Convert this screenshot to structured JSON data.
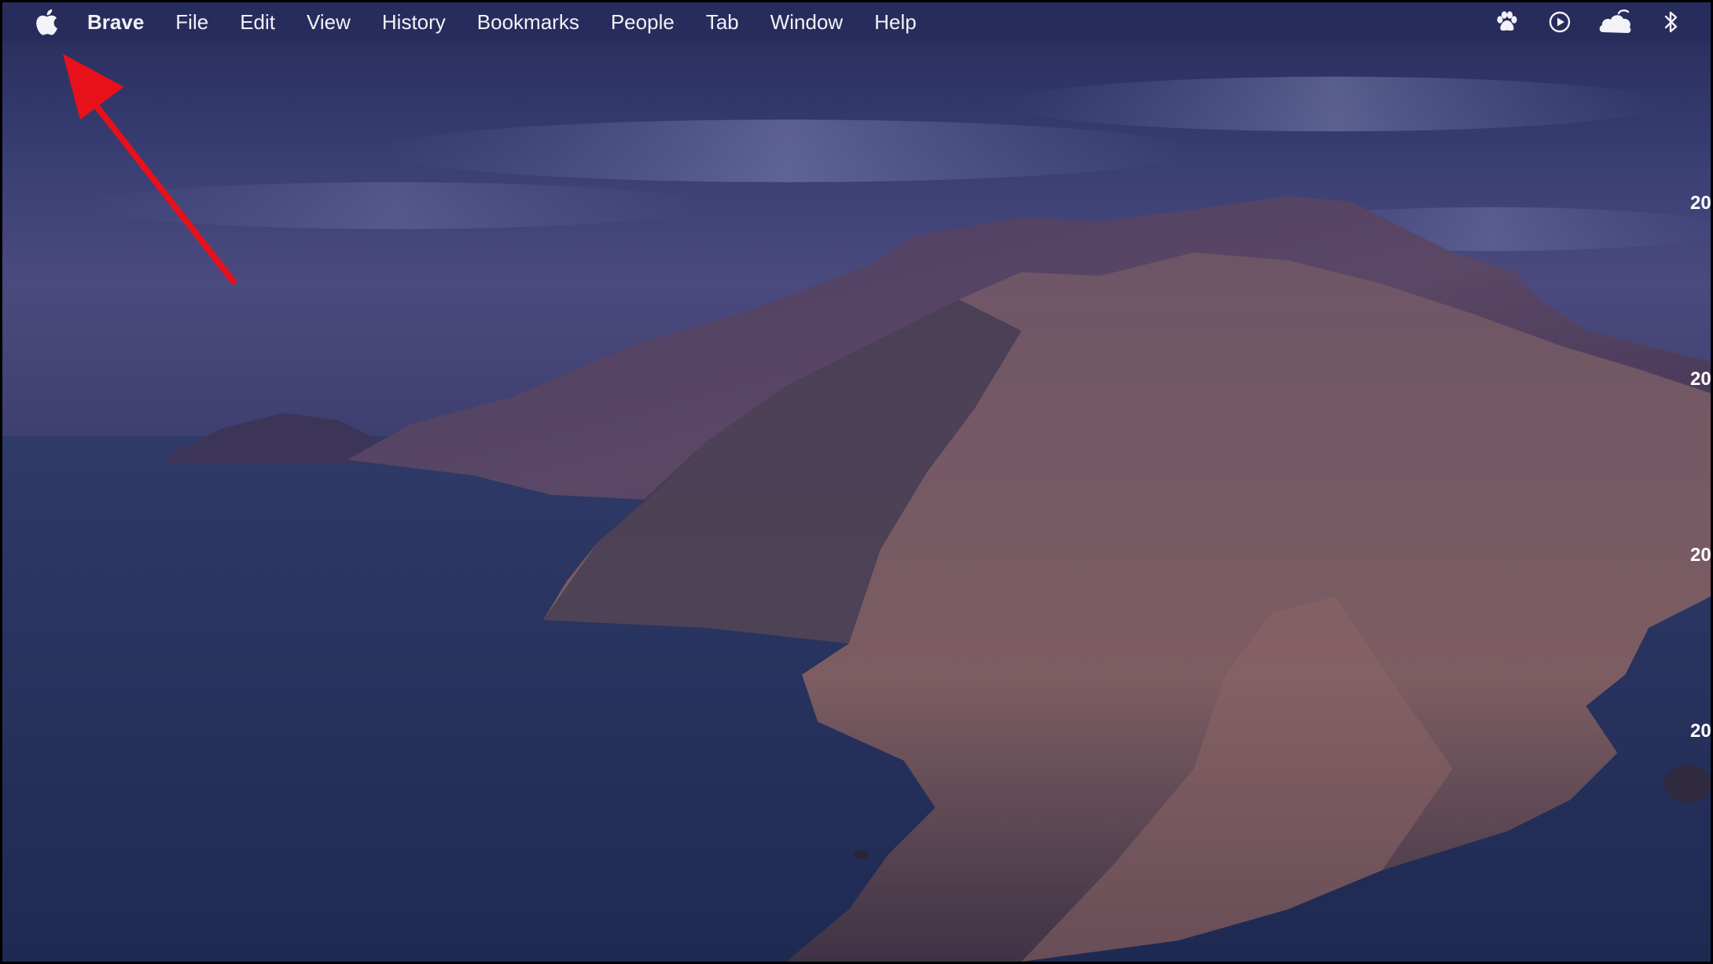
{
  "menubar": {
    "app_name": "Brave",
    "items": [
      {
        "name": "menu-file",
        "label": "File"
      },
      {
        "name": "menu-edit",
        "label": "Edit"
      },
      {
        "name": "menu-view",
        "label": "View"
      },
      {
        "name": "menu-history",
        "label": "History"
      },
      {
        "name": "menu-bookmarks",
        "label": "Bookmarks"
      },
      {
        "name": "menu-people",
        "label": "People"
      },
      {
        "name": "menu-tab",
        "label": "Tab"
      },
      {
        "name": "menu-window",
        "label": "Window"
      },
      {
        "name": "menu-help",
        "label": "Help"
      }
    ],
    "status_icons": [
      "paw-icon",
      "play-circle-icon",
      "cloud-icon",
      "bluetooth-icon"
    ]
  },
  "edge_labels": [
    "20",
    "20",
    "20",
    "20"
  ],
  "colors": {
    "menubar_bg": "#282c5c",
    "annotation_arrow": "#e8101b",
    "sky": "#2e3566",
    "sea": "#27335e"
  }
}
